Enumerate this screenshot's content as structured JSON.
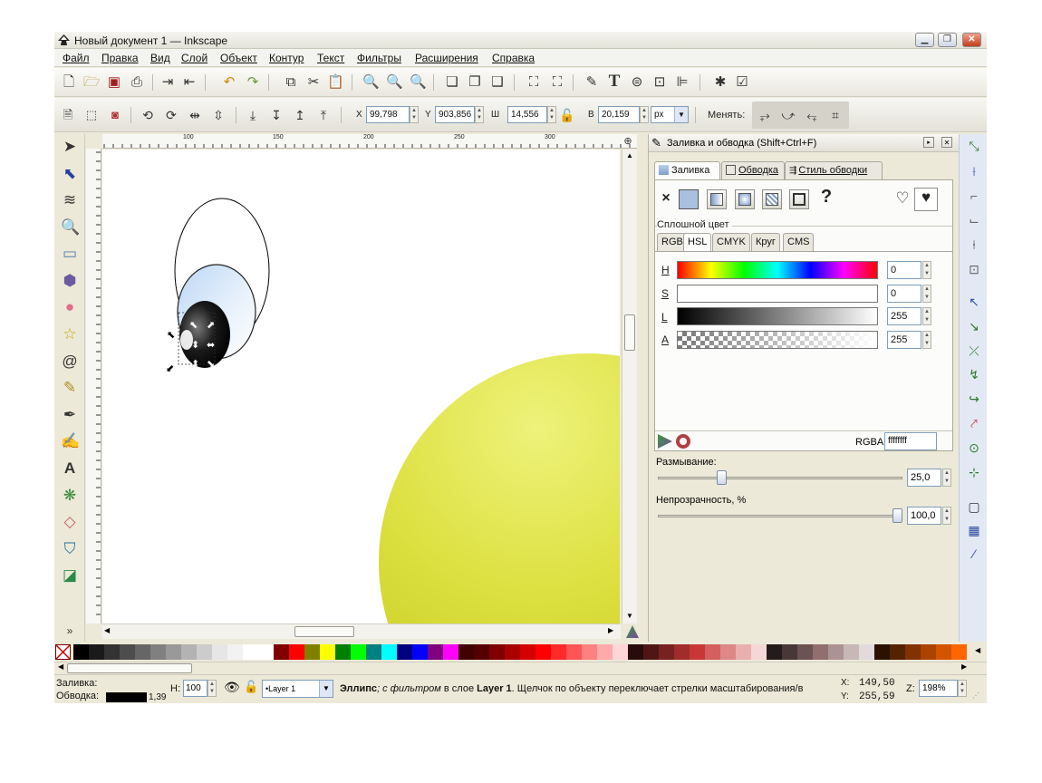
{
  "window": {
    "title": "Новый документ 1 — Inkscape"
  },
  "menu": [
    "Файл",
    "Правка",
    "Вид",
    "Слой",
    "Объект",
    "Контур",
    "Текст",
    "Фильтры",
    "Расширения",
    "Справка"
  ],
  "toolbar2": {
    "x_label": "X",
    "x_value": "99,798",
    "y_label": "Y",
    "y_value": "903,856",
    "w_label": "Ш",
    "w_value": "14,556",
    "h_label": "В",
    "h_value": "20,159",
    "unit": "px",
    "change_label": "Менять:"
  },
  "ruler_labels": [
    "100",
    "150",
    "200",
    "250",
    "300"
  ],
  "panel": {
    "title": "Заливка и обводка (Shift+Ctrl+F)",
    "tabs": [
      "Заливка",
      "Обводка",
      "Стиль обводки"
    ],
    "fill_type_x": "×",
    "fill_type_unknown": "?",
    "flat_color_label": "Сплошной цвет",
    "color_tabs": [
      "RGB",
      "HSL",
      "CMYK",
      "Круг",
      "CMS"
    ],
    "sliders": [
      {
        "label": "H",
        "value": "0"
      },
      {
        "label": "S",
        "value": "0"
      },
      {
        "label": "L",
        "value": "255"
      },
      {
        "label": "A",
        "value": "255"
      }
    ],
    "rgba_label": "RGBA:",
    "rgba_value": "ffffffff",
    "blur_label": "Размывание:",
    "blur_value": "25,0",
    "blur_fraction": 0.25,
    "opacity_label": "Непрозрачность, %",
    "opacity_value": "100,0",
    "opacity_fraction": 1.0
  },
  "palette_colors": [
    "#000000",
    "#1a1a1a",
    "#333333",
    "#4d4d4d",
    "#666666",
    "#808080",
    "#999999",
    "#b3b3b3",
    "#cccccc",
    "#e6e6e6",
    "#f2f2f2",
    "#ffffff",
    "#ffffff",
    "#800000",
    "#ff0000",
    "#808000",
    "#ffff00",
    "#008000",
    "#00ff00",
    "#008080",
    "#00ffff",
    "#000080",
    "#0000ff",
    "#800080",
    "#ff00ff",
    "#400000",
    "#550000",
    "#800000",
    "#aa0000",
    "#d40000",
    "#ff0000",
    "#ff2a2a",
    "#ff5555",
    "#ff8080",
    "#ffaaaa",
    "#ffd5d5",
    "#280b0b",
    "#501616",
    "#782121",
    "#a02c2c",
    "#c83737",
    "#d35f5f",
    "#de8787",
    "#e9afaf",
    "#f4d7d7",
    "#241c1c",
    "#483737",
    "#6c5353",
    "#916f6f",
    "#ac9393",
    "#c8b7b7",
    "#e3dbdb",
    "#2b1100",
    "#552200",
    "#803300",
    "#aa4400",
    "#d45500",
    "#ff6600"
  ],
  "status": {
    "fill_label": "Заливка:",
    "stroke_label": "Обводка:",
    "stroke_width": "1,39",
    "h_label": "Н:",
    "h_value": "100",
    "layer": "•Layer 1",
    "msg_obj": "Эллипс",
    "msg_filter": "; с фильтром",
    "msg_mid": " в слое ",
    "msg_layer": "Layer 1",
    "msg_tail": ". Щелчок по объекту переключает стрелки масштабирования/в",
    "x_label": "X:",
    "x_value": "149,50",
    "y_label": "Y:",
    "y_value": "255,59",
    "z_label": "Z:",
    "z_value": "198%"
  }
}
